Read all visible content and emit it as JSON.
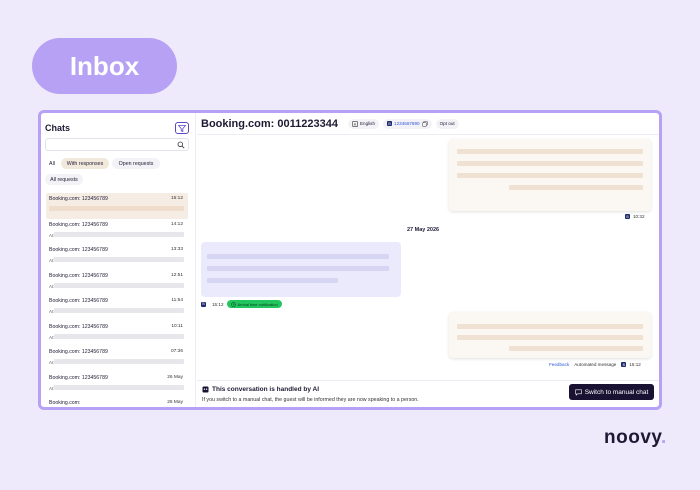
{
  "header": {
    "title": "Inbox"
  },
  "sidebar": {
    "title": "Chats",
    "search_placeholder": "",
    "tabs": [
      {
        "label": "All",
        "active": false
      },
      {
        "label": "With responses",
        "active": true
      },
      {
        "label": "Open requests",
        "active": false
      },
      {
        "label": "All requests",
        "active": false
      }
    ],
    "chats": [
      {
        "name": "Booking.com: 123456789",
        "time": "15:12",
        "ai": "",
        "selected": true
      },
      {
        "name": "Booking.com: 123456789",
        "time": "14:12",
        "ai": "AI:",
        "selected": false
      },
      {
        "name": "Booking.com: 123456789",
        "time": "13:33",
        "ai": "AI:",
        "selected": false
      },
      {
        "name": "Booking.com: 123456789",
        "time": "12:51",
        "ai": "AI:",
        "selected": false
      },
      {
        "name": "Booking.com: 123456789",
        "time": "11:54",
        "ai": "AI:",
        "selected": false
      },
      {
        "name": "Booking.com: 123456789",
        "time": "10:11",
        "ai": "AI:",
        "selected": false
      },
      {
        "name": "Booking.com: 123456789",
        "time": "07:36",
        "ai": "AI:",
        "selected": false
      },
      {
        "name": "Booking.com: 123456789",
        "time": "26 May",
        "ai": "AI:",
        "selected": false
      },
      {
        "name": "Booking.com:",
        "time": "26 May",
        "ai": "",
        "selected": false
      }
    ]
  },
  "conversation": {
    "title": "Booking.com: 0011223344",
    "language": "English",
    "reservation_id": "1234567890",
    "opt_out": "Opt out",
    "source_badge": "B",
    "messages": {
      "first_time": "10:32",
      "date_separator": "27 May 2026",
      "incoming_time": "15:12",
      "arrival_label": "Arrival time notification",
      "feedback": "Feedback",
      "automated": "Automated message",
      "last_time": "15:12"
    },
    "footer": {
      "title": "This conversation is handled by AI",
      "text": "If you switch to a manual chat, the guest will be informed they are now speaking to a person.",
      "button": "Switch to manual chat"
    }
  },
  "brand": {
    "logo": "noovy"
  },
  "colors": {
    "accent": "#b6a1f4",
    "button_dark": "#1a1233",
    "link": "#2f59d6",
    "arrival_green": "#22c55e",
    "background": "#efeafb"
  },
  "icons": [
    "filter-icon",
    "search-icon",
    "translate-icon",
    "copy-icon",
    "robot-icon",
    "clock-icon",
    "chat-icon"
  ]
}
